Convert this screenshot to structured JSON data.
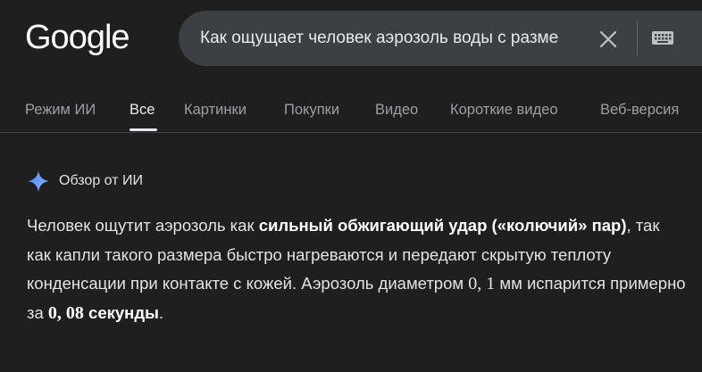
{
  "header": {
    "logo": "Google",
    "search": {
      "query": "Как ощущает человек аэрозоль воды с разме",
      "clear_icon": "close-icon",
      "keyboard_icon": "keyboard-icon"
    }
  },
  "tabs": [
    {
      "label": "Режим ИИ",
      "active": false
    },
    {
      "label": "Все",
      "active": true
    },
    {
      "label": "Картинки",
      "active": false
    },
    {
      "label": "Покупки",
      "active": false
    },
    {
      "label": "Видео",
      "active": false
    },
    {
      "label": "Короткие видео",
      "active": false
    },
    {
      "label": "Веб-версия",
      "active": false
    }
  ],
  "ai_overview": {
    "icon": "sparkle-icon",
    "title": "Обзор от ИИ",
    "answer": {
      "p1": "Человек ощутит аэрозоль как ",
      "b1": "сильный обжигающий удар («колючий» пар)",
      "p2": ", так как капли такого размера быстро нагреваются и передают скрытую теплоту конденсации при контакте с кожей. Аэрозоль диаметром ",
      "m1": "0, 1",
      "p3": " мм испарится примерно за ",
      "b2a": "0, 08",
      "b2b": " секунды",
      "p4": "."
    }
  },
  "colors": {
    "background": "#1f1f1f",
    "searchbar": "#3c4043",
    "sparkle": "#4c8df6"
  }
}
